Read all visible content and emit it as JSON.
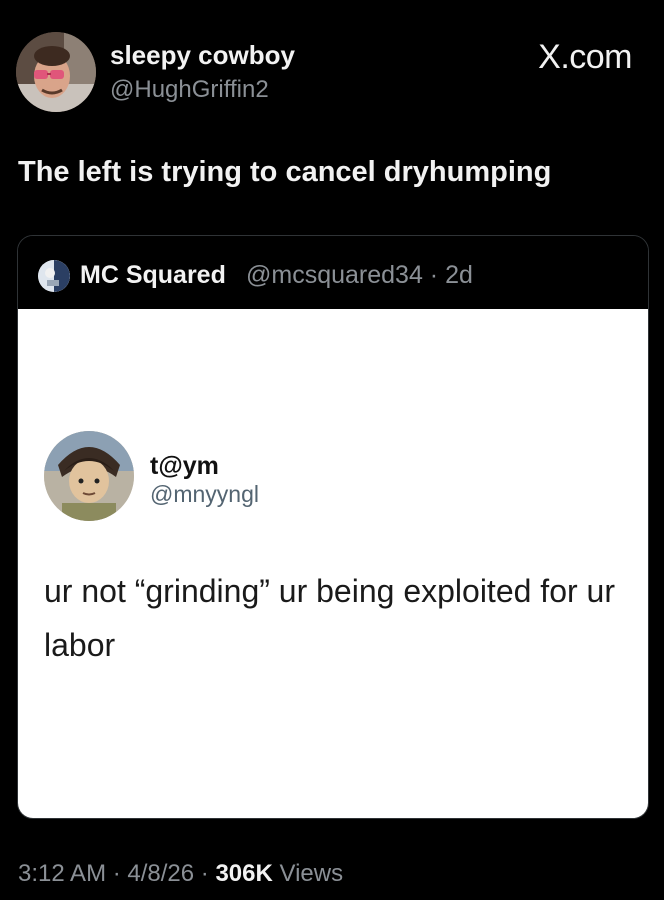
{
  "brand": "X.com",
  "author": {
    "name": "sleepy cowboy",
    "handle": "@HughGriffin2"
  },
  "post": {
    "text": "The left is trying to cancel dryhumping"
  },
  "quoted": {
    "name": "MC Squared",
    "handle_time": "@mcsquared34 · 2d",
    "inner": {
      "name": "t@ym",
      "handle": "@mnyyngl",
      "text": "ur not “grinding” ur being exploited for ur labor"
    }
  },
  "meta": {
    "time": "3:12 AM",
    "date": "4/8/26",
    "views_count": "306K",
    "views_label": "Views",
    "sep": " · "
  }
}
